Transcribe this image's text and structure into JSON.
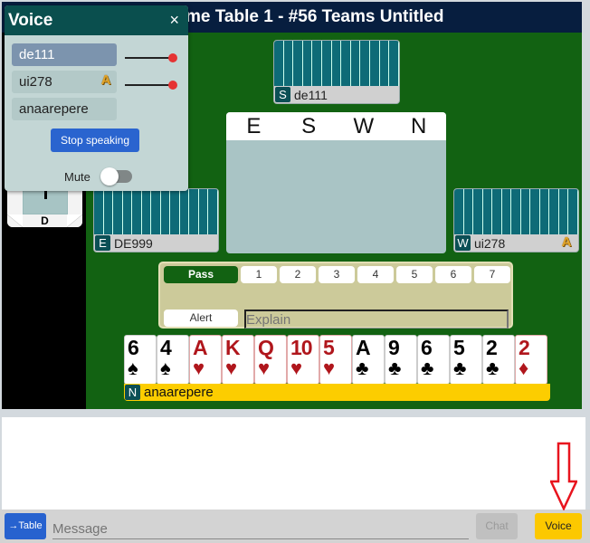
{
  "title": "me Table 1 - #56 Teams Untitled",
  "compass": {
    "dealer_label": "D"
  },
  "hands": {
    "south": {
      "seat": "S",
      "player": "de111",
      "cards_count": 13
    },
    "east": {
      "seat": "E",
      "player": "DE999",
      "cards_count": 13
    },
    "west": {
      "seat": "W",
      "player": "ui278",
      "cards_count": 13,
      "badge": "A"
    },
    "north": {
      "seat": "N",
      "player": "anaarepere",
      "cards": [
        {
          "rank": "6",
          "suit": "♠",
          "color": "black"
        },
        {
          "rank": "4",
          "suit": "♠",
          "color": "black"
        },
        {
          "rank": "A",
          "suit": "♥",
          "color": "red"
        },
        {
          "rank": "K",
          "suit": "♥",
          "color": "red"
        },
        {
          "rank": "Q",
          "suit": "♥",
          "color": "red"
        },
        {
          "rank": "10",
          "suit": "♥",
          "color": "red"
        },
        {
          "rank": "5",
          "suit": "♥",
          "color": "red"
        },
        {
          "rank": "A",
          "suit": "♣",
          "color": "black"
        },
        {
          "rank": "9",
          "suit": "♣",
          "color": "black"
        },
        {
          "rank": "6",
          "suit": "♣",
          "color": "black"
        },
        {
          "rank": "5",
          "suit": "♣",
          "color": "black"
        },
        {
          "rank": "2",
          "suit": "♣",
          "color": "black"
        },
        {
          "rank": "2",
          "suit": "♦",
          "color": "red"
        }
      ]
    }
  },
  "auction": {
    "columns": [
      "E",
      "S",
      "W",
      "N"
    ]
  },
  "bidding_box": {
    "pass_label": "Pass",
    "levels": [
      "1",
      "2",
      "3",
      "4",
      "5",
      "6",
      "7"
    ],
    "alert_label": "Alert",
    "explain_placeholder": "Explain"
  },
  "voice_panel": {
    "title": "Voice",
    "close_icon": "×",
    "users": [
      {
        "name": "de111",
        "speaking": true,
        "volume": 1.0
      },
      {
        "name": "ui278",
        "badge": "A",
        "volume": 1.0
      },
      {
        "name": "anaarepere"
      }
    ],
    "stop_label": "Stop speaking",
    "mute_label": "Mute",
    "mute_on": false
  },
  "chat": {
    "table_button": "→Table",
    "message_placeholder": "Message",
    "chat_button": "Chat",
    "voice_button": "Voice"
  },
  "colors": {
    "table_green": "#126212",
    "title_bg": "#071e3f",
    "card_back": "#0e6b77",
    "voice_accent": "#fcc800",
    "primary_button": "#2762cf",
    "annotation_arrow": "#e8141e"
  }
}
